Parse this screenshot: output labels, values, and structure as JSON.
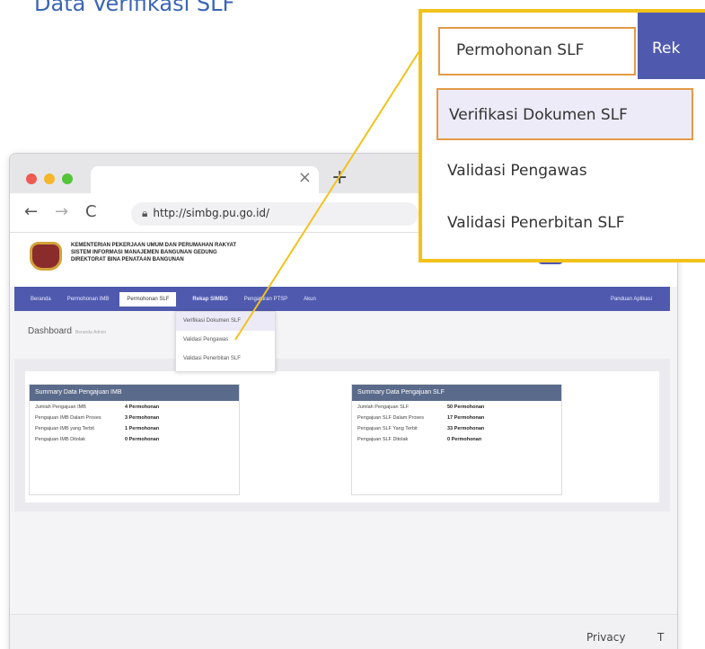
{
  "heading": "Data Verifikasi SLF",
  "browser": {
    "url": "http://simbg.pu.go.id/",
    "close_tab": "×",
    "new_tab": "+",
    "back": "←",
    "forward": "→",
    "reload": "C"
  },
  "site": {
    "org_lines": [
      "KEMENTERIAN PEKERJAAN UMUM DAN PERUMAHAN RAKYAT",
      "SISTEM INFORMASI MANAJEMEN BANGUNAN GEDUNG",
      "DIREKTORAT BINA PENATAAN BANGUNAN"
    ],
    "nav": [
      "Beranda",
      "Permohonan IMB",
      "Permohonan SLF",
      "Rekap SIMBG",
      "Pengaturan PTSP",
      "Akun",
      "Panduan Aplikasi"
    ],
    "submenu": [
      "Verifikasi Dokumen SLF",
      "Validasi Pengawas",
      "Validasi Penerbitan SLF"
    ],
    "dashboard": "Dashboard",
    "dashboard_sub": "Beranda Admin",
    "imb_card": {
      "title": "Summary Data Pengajuan IMB",
      "rows": [
        {
          "k": "Jumlah Pengajuan IMB",
          "v": "4 Permohonan"
        },
        {
          "k": "Pengajuan IMB Dalam Proses",
          "v": "3 Permohonan"
        },
        {
          "k": "Pengajuan IMB yang Terbit",
          "v": "1 Permohonan"
        },
        {
          "k": "Pengajuan IMB Ditolak",
          "v": "0 Permohonan"
        }
      ]
    },
    "slf_card": {
      "title": "Summary Data Pengajuan SLF",
      "rows": [
        {
          "k": "Jumlah Pengajuan SLF",
          "v": "50 Permohonan"
        },
        {
          "k": "Pengajuan SLF Dalam Proses",
          "v": "17 Permohonan"
        },
        {
          "k": "Pengajuan SLF Yang Terbit",
          "v": "33 Permohonan"
        },
        {
          "k": "Pengajuan SLF Ditolak",
          "v": "0 Permohonan"
        }
      ]
    },
    "footer_privacy": "Privacy",
    "footer_t": "T"
  },
  "zoom": {
    "tab": "Permohonan SLF",
    "next": "Rek",
    "items": [
      "Verifikasi Dokumen SLF",
      "Validasi Pengawas",
      "Validasi Penerbitan SLF"
    ]
  },
  "colors": {
    "accent": "#4f5aae",
    "callout": "#f2c21b",
    "highlight": "#e49a48",
    "heading": "#3a66b4"
  }
}
